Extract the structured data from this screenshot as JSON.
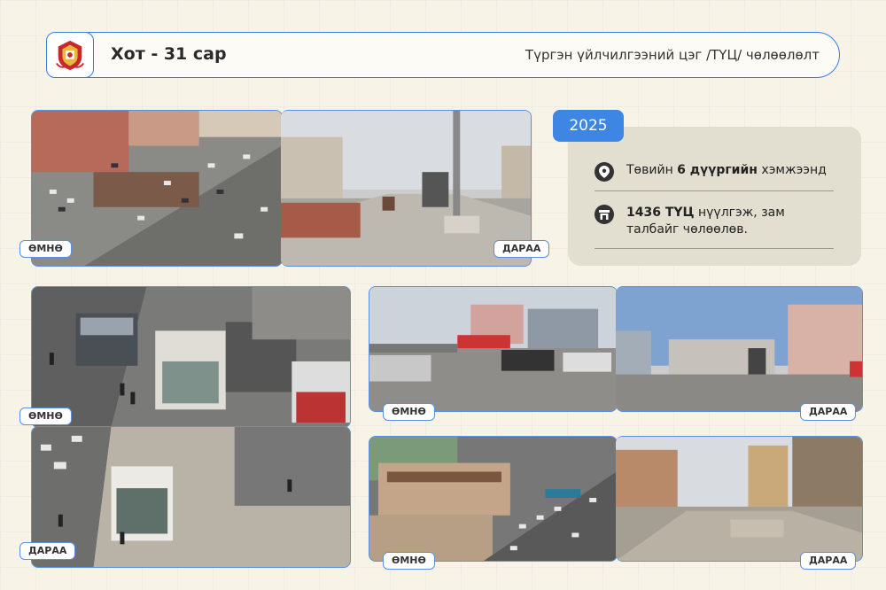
{
  "header": {
    "title": "Хот - 31 сар",
    "subtitle": "Түргэн үйлчилгээний цэг /ТҮЦ/ чөлөөлөлт",
    "logo_icon": "city-emblem-icon"
  },
  "year_badge": "2025",
  "info": {
    "items": [
      {
        "icon": "location-pin-icon",
        "pre": "Төвийн ",
        "bold": "6 дүүргийн",
        "post": " хэмжээнд"
      },
      {
        "icon": "kiosk-icon",
        "pre": "",
        "bold": "1436 ТҮЦ",
        "post": " нүүлгэж, зам талбайг чөлөөлөв."
      }
    ]
  },
  "labels": {
    "before": "ӨМНӨ",
    "after": "ДАРАА"
  },
  "colors": {
    "accent": "#3e86e3",
    "border": "#5b8fe0",
    "background": "#f7f3e6",
    "info_panel": "#e2dfd0"
  }
}
